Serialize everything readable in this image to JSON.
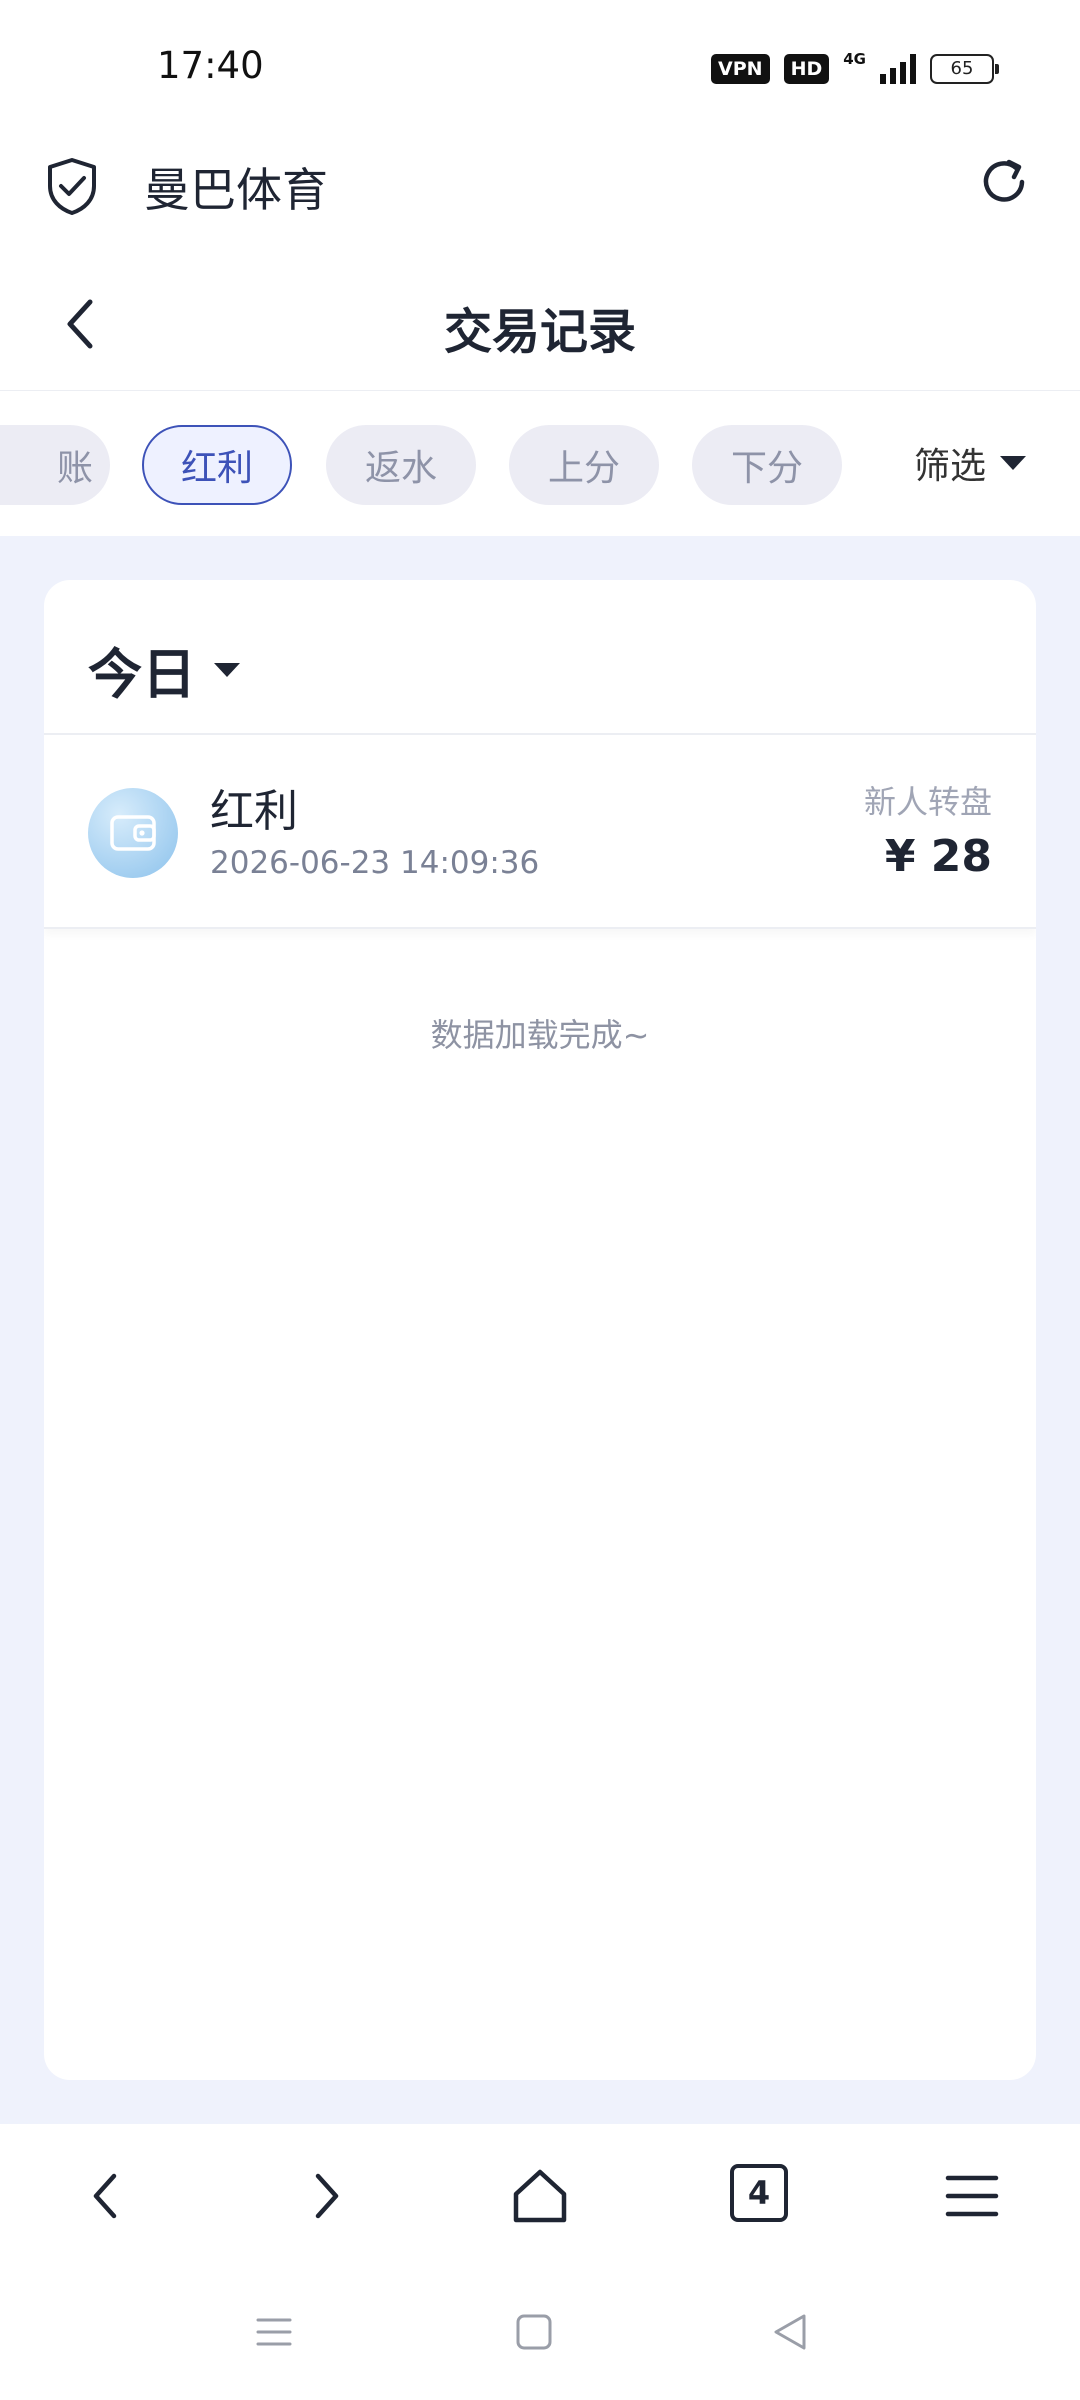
{
  "status_bar": {
    "time": "17:40",
    "vpn": "VPN",
    "hd": "HD",
    "network": "4G",
    "battery": "65"
  },
  "browser": {
    "site_name": "曼巴体育",
    "icons": {
      "security": "shield-check-icon",
      "refresh": "refresh-icon"
    }
  },
  "header": {
    "title": "交易记录",
    "back_icon": "chevron-left-icon"
  },
  "tabs": {
    "items": [
      {
        "label": "账",
        "active": false
      },
      {
        "label": "红利",
        "active": true
      },
      {
        "label": "返水",
        "active": false
      },
      {
        "label": "上分",
        "active": false
      },
      {
        "label": "下分",
        "active": false
      }
    ],
    "filter_label": "筛选"
  },
  "date_selector": {
    "label": "今日"
  },
  "records": [
    {
      "type": "红利",
      "time": "2026-06-23 14:09:36",
      "source": "新人转盘",
      "amount": "¥ 28",
      "icon": "wallet-icon"
    }
  ],
  "load_status": "数据加载完成~",
  "browser_nav": {
    "tab_count": "4",
    "icons": [
      "back-icon",
      "forward-icon",
      "home-icon",
      "tabs-icon",
      "menu-icon"
    ]
  },
  "system_nav": {
    "icons": [
      "recent-apps-icon",
      "home-square-icon",
      "back-triangle-icon"
    ]
  },
  "colors": {
    "accent": "#3d52b8",
    "content_background": "#eff2fc",
    "chip_background": "#ececf4"
  }
}
